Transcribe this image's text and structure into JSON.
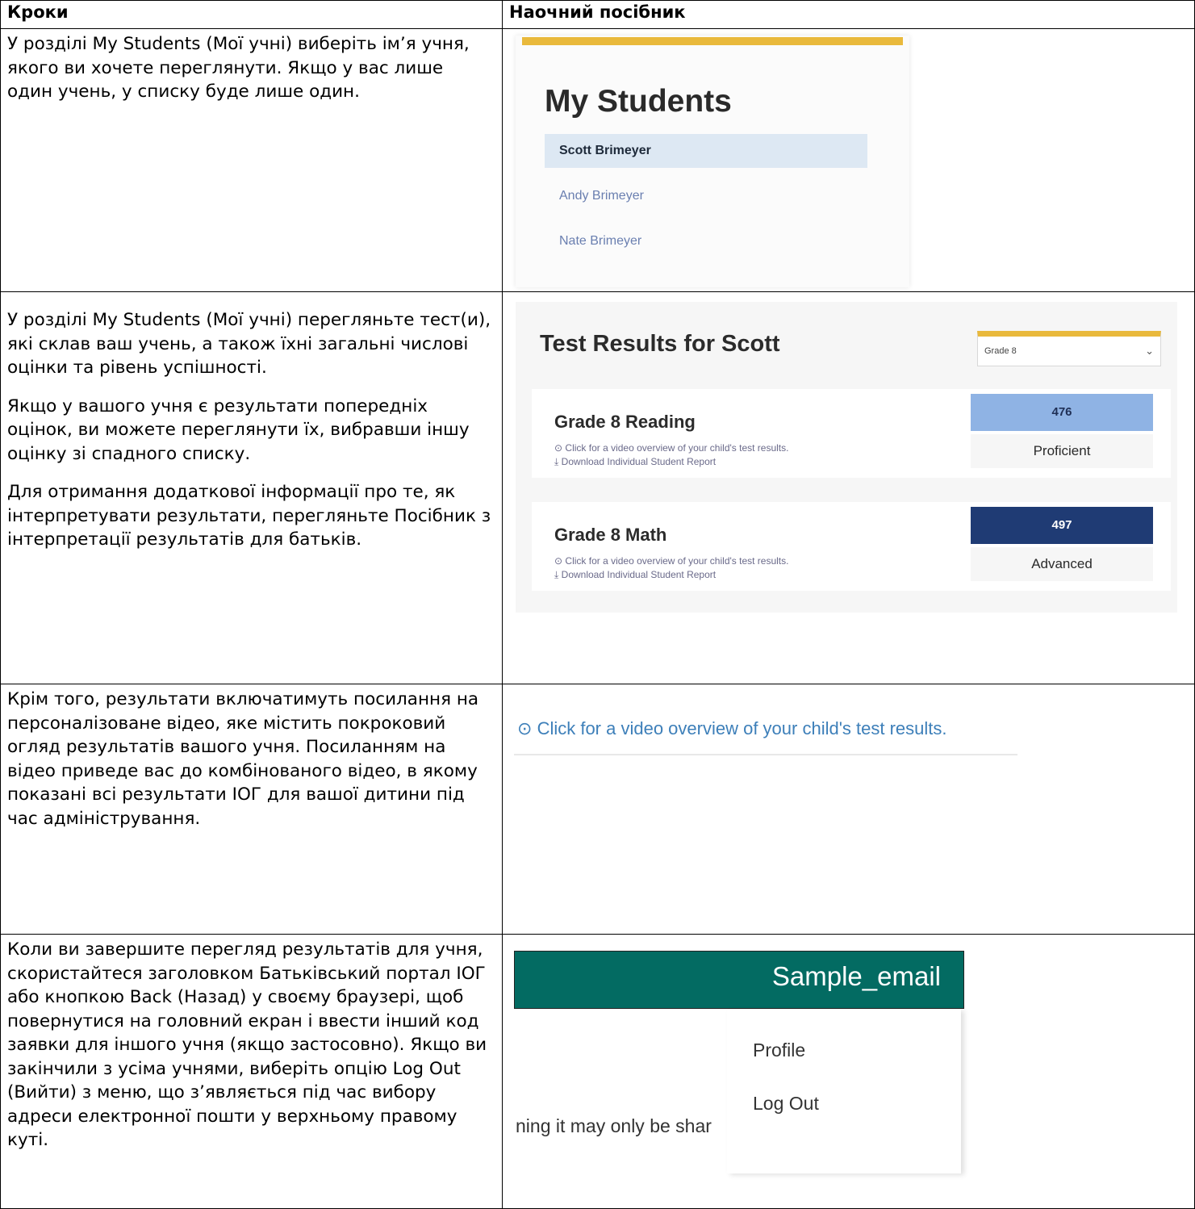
{
  "table": {
    "headers": [
      "Кроки",
      "Наочний посібник"
    ]
  },
  "rows": [
    {
      "steps": [
        "У розділі My Students (Мої учні) виберіть ім’я учня, якого ви хочете переглянути. Якщо у вас лише один учень, у списку буде лише один."
      ]
    },
    {
      "steps": [
        "У розділі My Students (Мої учні) перегляньте тест(и), які склав ваш учень, а також їхні загальні числові оцінки та рівень успішності.",
        "Якщо у вашого учня є результати попередніх оцінок, ви можете переглянути їх, вибравши іншу оцінку зі спадного списку.",
        "Для отримання додаткової інформації про те, як інтерпретувати результати, перегляньте Посібник з інтерпретації результатів для батьків."
      ]
    },
    {
      "steps": [
        "Крім того, результати включатимуть посилання на персоналізоване відео, яке містить покроковий огляд результатів вашого учня. Посиланням на відео приведе вас до комбінованого відео, в якому показані всі результати ІОГ для вашої дитини під час адміністрування."
      ]
    },
    {
      "steps": [
        "Коли ви завершите перегляд результатів для учня, скористайтеся заголовком Батьківський портал ІОГ або кнопкою Back (Назад) у своєму браузері, щоб повернутися на головний екран і ввести інший код заявки для іншого учня (якщо застосовно). Якщо ви закінчили з усіма учнями, виберіть опцію Log Out (Вийти) з меню, що з’являється під час вибору адреси електронної пошти у верхньому правому куті."
      ]
    }
  ],
  "my_students": {
    "title": "My Students",
    "students": [
      "Scott Brimeyer",
      "Andy Brimeyer",
      "Nate Brimeyer"
    ],
    "selected_index": 0
  },
  "test_results": {
    "title": "Test Results for Scott",
    "grade_select": "Grade 8",
    "video_link": "Click for a video overview of your child's test results.",
    "download_link": "Download Individual Student Report",
    "tests": [
      {
        "subject": "Grade 8 Reading",
        "score": "476",
        "level": "Proficient"
      },
      {
        "subject": "Grade 8 Math",
        "score": "497",
        "level": "Advanced"
      }
    ]
  },
  "video_link_zoom": {
    "text": "Click for a video overview of your child's test results."
  },
  "email_menu": {
    "email": "Sample_email",
    "items": [
      "Profile",
      "Log Out"
    ],
    "behind_text": "ning it may only be shar"
  },
  "colors": {
    "accent_yellow": "#e9b93c",
    "proficient": "#8fb3e4",
    "advanced": "#1f3b74",
    "teal": "#036b62"
  }
}
